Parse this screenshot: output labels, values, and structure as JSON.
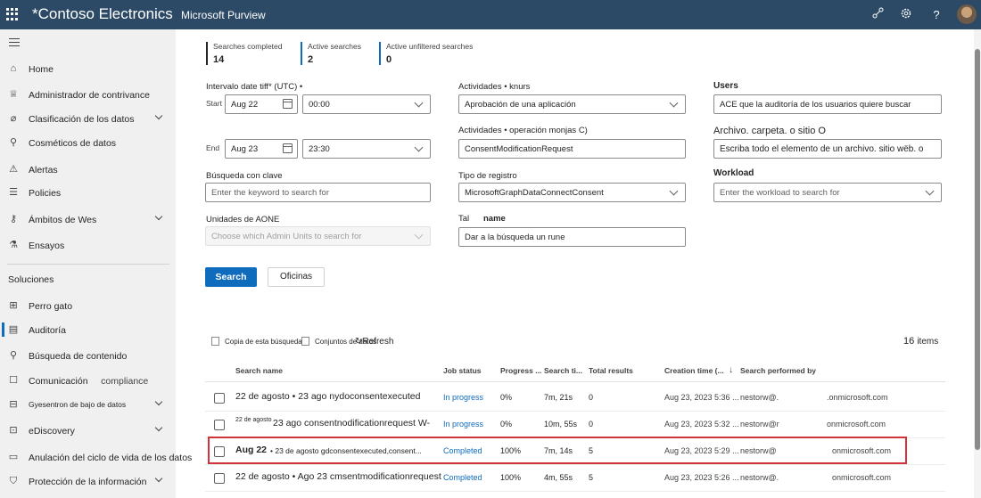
{
  "topbar": {
    "org": "*Contoso Electronics",
    "app": "Microsoft Purview",
    "icons": [
      "waffle-icon",
      "connections-icon",
      "gear-icon",
      "help-icon",
      "avatar"
    ]
  },
  "sidebar": {
    "items": [
      {
        "label": "Home",
        "icon": "home-icon"
      },
      {
        "label": "Administrador de contrivance",
        "icon": "trophy-icon"
      },
      {
        "label": "Clasificación de los datos",
        "icon": "tag-icon"
      },
      {
        "label": "Cosméticos de datos",
        "icon": "connector-icon"
      },
      {
        "label": "Alertas",
        "icon": "alert-icon"
      },
      {
        "label": "Policies",
        "icon": "sliders-icon"
      },
      {
        "label": "Ámbitos de Wes",
        "icon": "key-icon"
      },
      {
        "label": "Ensayos",
        "icon": "flask-icon"
      },
      {
        "label": "Perro gato",
        "icon": "grid-icon"
      },
      {
        "label": "Auditoría",
        "icon": "audit-icon"
      },
      {
        "label": "Búsqueda de contenido",
        "icon": "search-icon"
      },
      {
        "label": "Comunicación",
        "icon": "chat-icon"
      },
      {
        "label": "Gyesentron de bajo de datos",
        "icon": "lock-icon"
      },
      {
        "label": "eDiscovery",
        "icon": "ediscovery-icon"
      },
      {
        "label": "Anulación del ciclo de vida de los datos",
        "icon": "archive-icon"
      },
      {
        "label": "Protección de la información",
        "icon": "shield-icon"
      }
    ],
    "comm_suffix": "compliance",
    "section_solutions": "Soluciones"
  },
  "stats": [
    {
      "label": "Searches completed",
      "value": "14"
    },
    {
      "label": "Active searches",
      "value": "2"
    },
    {
      "label": "Active unfiltered searches",
      "value": "0"
    }
  ],
  "form": {
    "date_label": "Intervalo date tiff* (UTC) •",
    "start_label": "Start",
    "end_label": "End",
    "start_date": "Aug 22",
    "start_time": "00:00",
    "end_date": "Aug 23",
    "end_time": "23:30",
    "keyword_label": "Búsqueda con clave",
    "keyword_placeholder": "Enter the keyword to search for",
    "admin_units_label": "Unidades de AONE",
    "admin_units_placeholder": "Choose which Admin Units to search for",
    "activities_label": "Actividades • knurs",
    "activities_value": "Aprobación de una aplicación",
    "operations_label": "Actividades • operación monjas C)",
    "operations_value": "ConsentModificationRequest",
    "record_type_label": "Tipo de registro",
    "record_type_value": "MicrosoftGraphDataConnectConsent",
    "name_label_a": "Tal",
    "name_label_b": "name",
    "name_value": "Dar a la búsqueda un rune",
    "users_label": "Users",
    "users_value": "ACE que la auditoría de los usuarios quiere buscar",
    "file_label": "Archivo. carpeta. o sitio O",
    "file_value": "Escriba todo el elemento de un archivo. sitio wëb. o",
    "workload_label": "Workload",
    "workload_placeholder": "Enter the workload to search for",
    "search_button": "Search",
    "secondary_button": "Oficinas"
  },
  "toolbar": {
    "copy": "Copia de esta búsqueda",
    "sets": "Conjuntos de datos",
    "refresh": "Refresh",
    "count": "16",
    "count_suffix": "items"
  },
  "table": {
    "headers": [
      "Search name",
      "Job status",
      "Progress ...",
      "Search ti...",
      "Total results",
      "Creation time (...",
      "Search performed by"
    ],
    "rows": [
      {
        "name": "22 de agosto • 23 ago nydoconsentexecuted",
        "name_prefix": "",
        "status": "In progress",
        "progress": "0%",
        "time": "7m, 21s",
        "results": "0",
        "created": "Aug 23, 2023 5:36 ...",
        "by": "nestorw@.",
        "domain": ".onmicrosoft.com"
      },
      {
        "name": "23 ago consentnodificationrequest W-",
        "name_prefix": "22 de agosto",
        "status": "In progress",
        "progress": "0%",
        "time": "10m, 55s",
        "results": "0",
        "created": "Aug 23, 2023 5:32 ...",
        "by": "nestorw@r",
        "domain": "onmicrosoft.com"
      },
      {
        "name": "• 23 de agosto gdconsentexecuted,consent...",
        "name_prefix": "Aug 22",
        "status": "Completed",
        "progress": "100%",
        "time": "7m, 14s",
        "results": "5",
        "created": "Aug 23, 2023 5:29 ...",
        "by": "nestorw@",
        "domain": "onmicrosoft.com"
      },
      {
        "name": "22 de agosto • Ago 23 cmsentmodificationrequest",
        "name_prefix": "",
        "status": "Completed",
        "progress": "100%",
        "time": "4m, 55s",
        "results": "5",
        "created": "Aug 23, 2023 5:26 ...",
        "by": "nestorw@.",
        "domain": "onmicrosoft.com"
      }
    ]
  },
  "colors": {
    "accent": "#0f6cbd",
    "topbar": "#2c4a66",
    "highlight": "#d13438"
  }
}
